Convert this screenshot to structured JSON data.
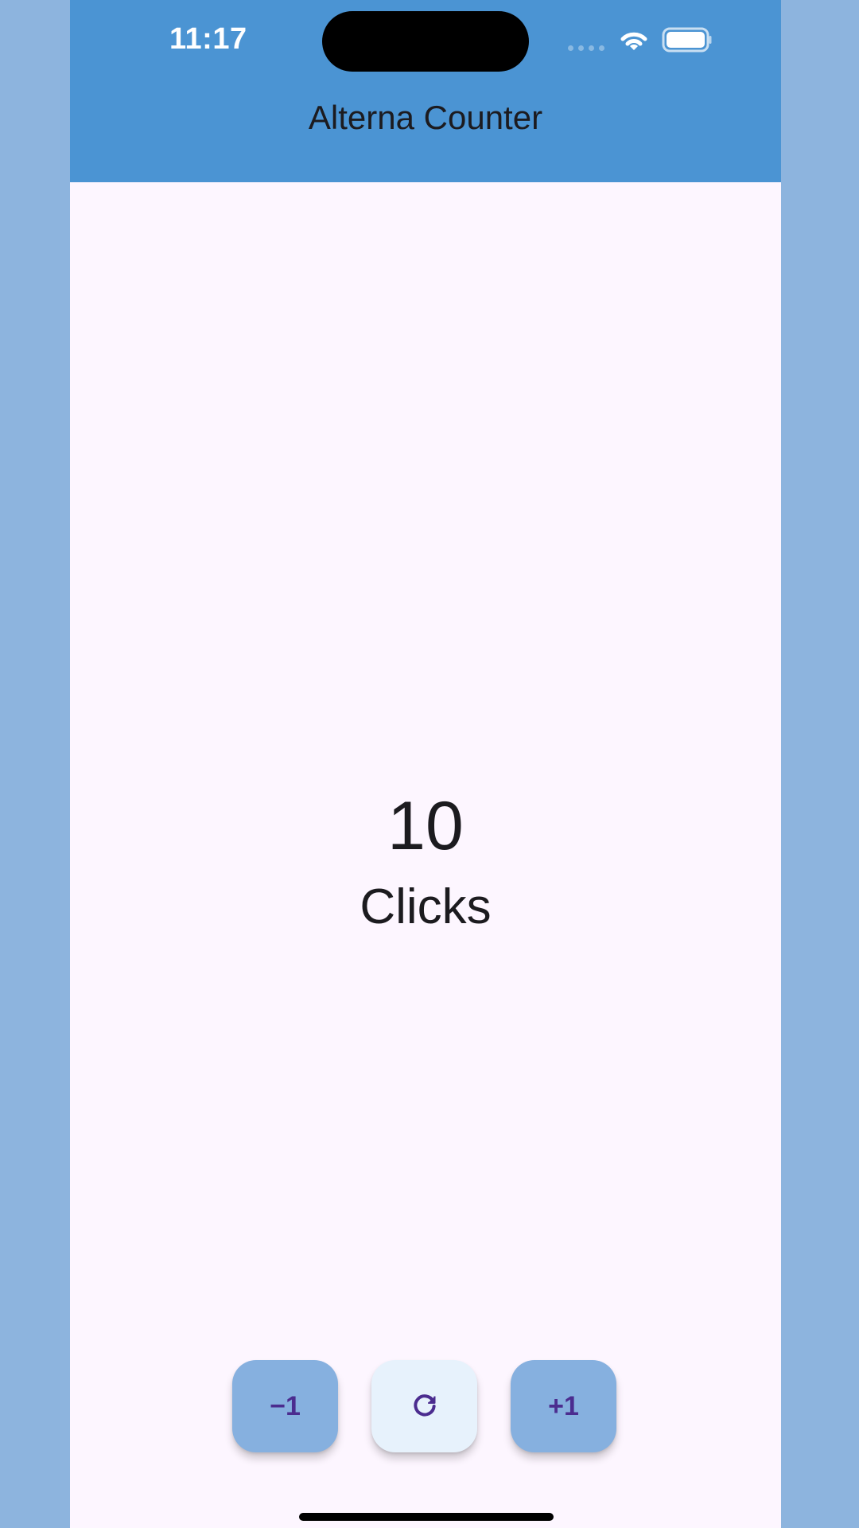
{
  "status_bar": {
    "time": "11:17",
    "icons": [
      "signal-icon",
      "wifi-icon",
      "battery-icon"
    ]
  },
  "app_bar": {
    "title": "Alterna Counter"
  },
  "counter": {
    "value": "10",
    "label": "Clicks"
  },
  "actions": {
    "decrement_label": "−1",
    "reset_icon": "refresh-icon",
    "increment_label": "+1"
  },
  "colors": {
    "header": "#4b94d3",
    "surface": "#fdf6ff",
    "outer_background": "#8db4de",
    "button_primary": "#86b0df",
    "button_reset": "#e7f2fc",
    "button_text": "#4b2c8f",
    "text": "#1c1b1f"
  }
}
